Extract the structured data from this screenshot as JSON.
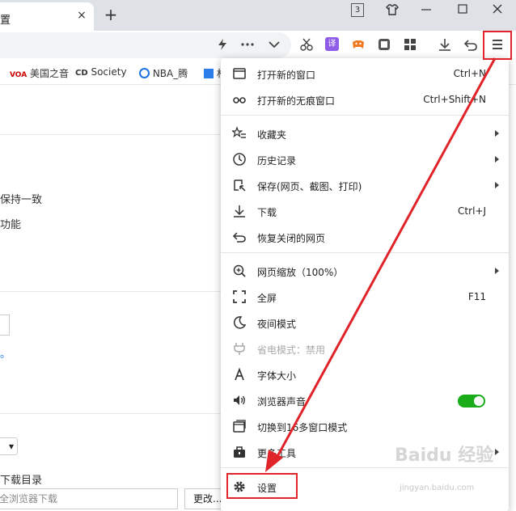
{
  "tab": {
    "title": "置",
    "close": "×",
    "new_tab": "+"
  },
  "window": {
    "badge": "3"
  },
  "bookmarks": [
    {
      "label": "美国之音",
      "icon": "voa-icon"
    },
    {
      "label": "Society",
      "icon": "cd-icon"
    },
    {
      "label": "NBA_腾",
      "icon": "nba-icon"
    },
    {
      "label": "材",
      "icon": "bookmark-icon"
    }
  ],
  "page": {
    "text1": "保持一致",
    "text2": "功能",
    "text3": "。",
    "download_dir_label": "下载目录",
    "download_input": "全浏览器下载",
    "change_button": "更改...",
    "select_arrow": "▾"
  },
  "menu": {
    "items": [
      {
        "label": "打开新的窗口",
        "shortcut": "Ctrl+N",
        "icon": "window-icon"
      },
      {
        "label": "打开新的无痕窗口",
        "shortcut": "Ctrl+Shift+N",
        "icon": "incognito-icon"
      },
      {
        "label": "收藏夹",
        "icon": "star-list-icon",
        "submenu": true
      },
      {
        "label": "历史记录",
        "icon": "clock-icon",
        "submenu": true
      },
      {
        "label": "保存(网页、截图、打印)",
        "icon": "save-icon",
        "submenu": true
      },
      {
        "label": "下载",
        "shortcut": "Ctrl+J",
        "icon": "download-icon"
      },
      {
        "label": "恢复关闭的网页",
        "icon": "undo-icon"
      },
      {
        "label": "网页缩放（100%）",
        "icon": "zoom-icon",
        "submenu": true
      },
      {
        "label": "全屏",
        "shortcut": "F11",
        "icon": "fullscreen-icon"
      },
      {
        "label": "夜间模式",
        "icon": "moon-icon"
      },
      {
        "label": "省电模式：禁用",
        "icon": "plug-icon",
        "disabled": true
      },
      {
        "label": "字体大小",
        "icon": "font-icon"
      },
      {
        "label": "浏览器声音",
        "icon": "speaker-icon",
        "toggle": true
      },
      {
        "label": "切换到16多窗口模式",
        "icon": "multiwindow-icon"
      },
      {
        "label": "更多工具",
        "icon": "toolbox-icon",
        "submenu": true
      },
      {
        "label": "设置",
        "icon": "gear-icon"
      }
    ]
  },
  "colors": {
    "highlight": "#e0242a",
    "toggle_on": "#1aad19"
  },
  "watermark": {
    "line1": "Baidu 经验",
    "line2": "jingyan.baidu.com"
  }
}
